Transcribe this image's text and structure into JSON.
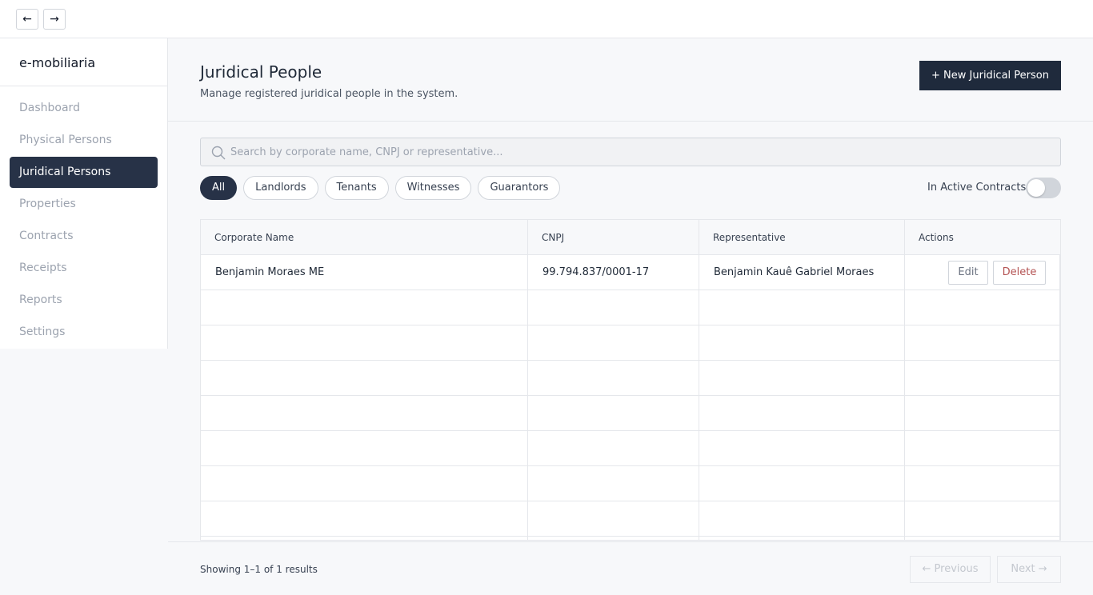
{
  "topbar": {
    "back_label": "←",
    "forward_label": "→"
  },
  "sidebar": {
    "brand": "e-mobiliaria",
    "items": [
      {
        "label": "Dashboard",
        "active": false
      },
      {
        "label": "Physical Persons",
        "active": false
      },
      {
        "label": "Juridical Persons",
        "active": true
      },
      {
        "label": "Properties",
        "active": false
      },
      {
        "label": "Contracts",
        "active": false
      },
      {
        "label": "Receipts",
        "active": false
      },
      {
        "label": "Reports",
        "active": false
      },
      {
        "label": "Settings",
        "active": false
      }
    ]
  },
  "header": {
    "title": "Juridical People",
    "subtitle": "Manage registered juridical people in the system.",
    "new_button": "+ New Juridical Person"
  },
  "search": {
    "placeholder": "Search by corporate name, CNPJ or representative...",
    "value": "",
    "icon": "search-icon"
  },
  "filters": {
    "chips": [
      {
        "label": "All",
        "active": true
      },
      {
        "label": "Landlords",
        "active": false
      },
      {
        "label": "Tenants",
        "active": false
      },
      {
        "label": "Witnesses",
        "active": false
      },
      {
        "label": "Guarantors",
        "active": false
      }
    ],
    "toggle_label": "In Active Contracts",
    "toggle_on": false
  },
  "table": {
    "columns": [
      "Corporate Name",
      "CNPJ",
      "Representative",
      "Actions"
    ],
    "rows": [
      {
        "name": "Benjamin Moraes ME",
        "cnpj": "99.794.837/0001-17",
        "representative": "Benjamin Kauê Gabriel Moraes"
      }
    ],
    "edit_label": "Edit",
    "delete_label": "Delete"
  },
  "footer": {
    "results": "Showing 1–1 of 1 results",
    "prev_label": "← Previous",
    "next_label": "Next →"
  },
  "colors": {
    "accent": "#273247",
    "primary_button": "#1f2a3c",
    "danger": "#b45353"
  }
}
